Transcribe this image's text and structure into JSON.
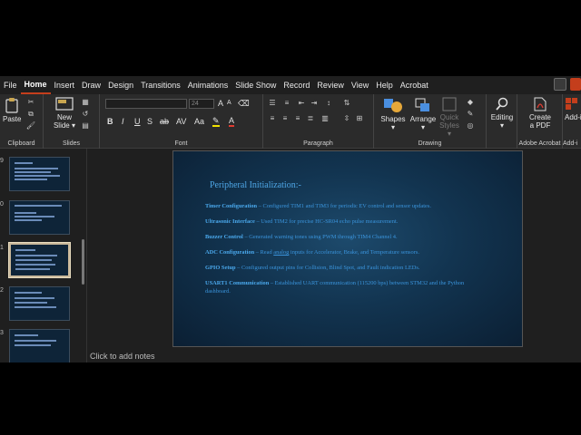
{
  "menu": {
    "tabs": [
      "File",
      "Home",
      "Insert",
      "Draw",
      "Design",
      "Transitions",
      "Animations",
      "Slide Show",
      "Record",
      "Review",
      "View",
      "Help",
      "Acrobat"
    ],
    "active_tab": "Home"
  },
  "ribbon": {
    "clipboard": {
      "paste_label": "Paste",
      "group_label": "Clipboard"
    },
    "slides": {
      "new_slide_line1": "New",
      "new_slide_line2": "Slide",
      "group_label": "Slides"
    },
    "font": {
      "size_value": "24",
      "group_label": "Font",
      "bold": "B",
      "italic": "I",
      "underline": "U",
      "strike": "S",
      "grow": "A",
      "shrink": "A",
      "aa": "Aa"
    },
    "paragraph": {
      "group_label": "Paragraph"
    },
    "drawing": {
      "shapes_label": "Shapes",
      "arrange_label": "Arrange",
      "quick_styles_line1": "Quick",
      "quick_styles_line2": "Styles",
      "group_label": "Drawing"
    },
    "editing": {
      "label": "Editing"
    },
    "acrobat": {
      "create_line1": "Create",
      "create_line2": "a PDF",
      "group_label": "Adobe Acrobat"
    },
    "addins": {
      "label": "Add-i",
      "group_label": "Add-i"
    }
  },
  "thumbnails": {
    "numbers": [
      "9",
      "0",
      "1",
      "2",
      "3"
    ],
    "selected_index": 2
  },
  "slide": {
    "title": "Peripheral Initialization:-",
    "bullets": [
      {
        "head": "Timer Configuration",
        "text": " – Configured TIM1 and TIM3 for periodic EV control and sensor updates."
      },
      {
        "head": "Ultrasonic Interface",
        "text": " – Used TIM2 for precise HC-SR04 echo pulse measurement."
      },
      {
        "head": " Buzzer Control",
        "text": " – Generated warning tones using PWM through TIM4 Channel 4."
      },
      {
        "head": " ADC Configuration",
        "text_before": " – Read ",
        "underlined": "analog",
        "text_after": " inputs for Accelerator, Brake, and Temperature sensors."
      },
      {
        "head": "GPIO Setup",
        "text": " – Configured output pins for Collision, Blind Spot, and Fault indication LEDs."
      },
      {
        "head": "USART1 Communication",
        "text": " – Established UART communication (115200 bps) between STM32 and the Python dashboard."
      }
    ]
  },
  "notes_placeholder": "Click to add notes"
}
